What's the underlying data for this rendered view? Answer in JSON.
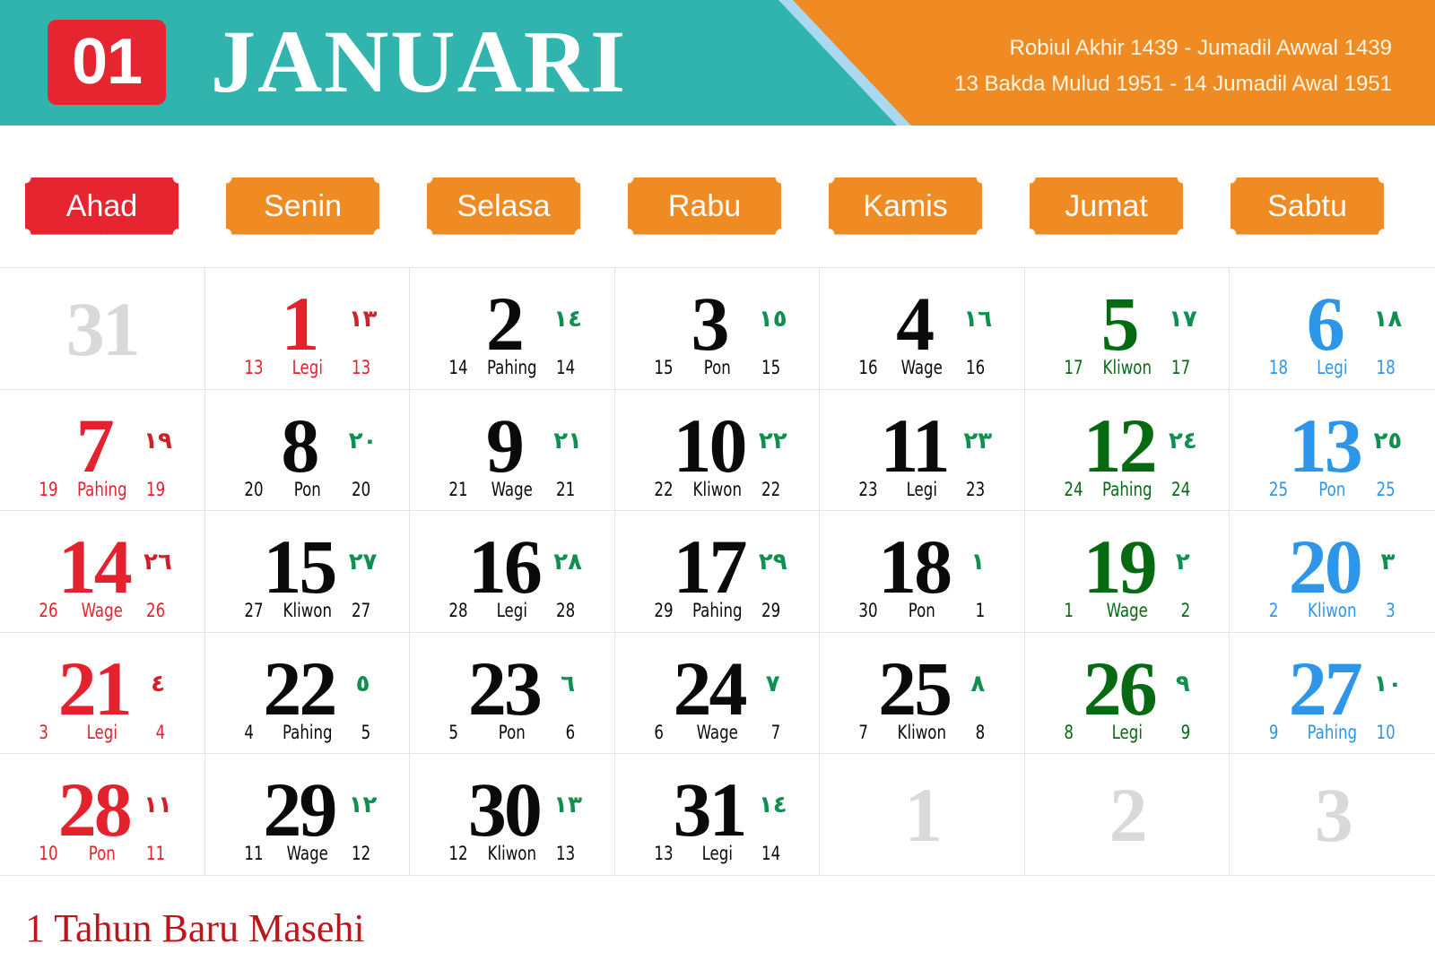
{
  "header": {
    "month_number": "01",
    "month_name": "JANUARI",
    "hijri_line": "Robiul Akhir 1439 - Jumadil Awwal 1439",
    "javanese_line": "13 Bakda Mulud 1951 - 14 Jumadil Awal 1951",
    "colors": {
      "teal": "#30b4ad",
      "orange": "#f08a22",
      "stripe": "#a9d8f0",
      "red": "#e62530"
    }
  },
  "weekdays": [
    "Ahad",
    "Senin",
    "Selasa",
    "Rabu",
    "Kamis",
    "Jumat",
    "Sabtu"
  ],
  "weeks": [
    [
      {
        "day": "31",
        "color": "grey",
        "arab": "",
        "left": "",
        "pasaran": "",
        "right": ""
      },
      {
        "day": "1",
        "color": "red",
        "arab": "١٣",
        "left": "13",
        "pasaran": "Legi",
        "right": "13"
      },
      {
        "day": "2",
        "color": "black",
        "arab": "١٤",
        "left": "14",
        "pasaran": "Pahing",
        "right": "14"
      },
      {
        "day": "3",
        "color": "black",
        "arab": "١٥",
        "left": "15",
        "pasaran": "Pon",
        "right": "15"
      },
      {
        "day": "4",
        "color": "black",
        "arab": "١٦",
        "left": "16",
        "pasaran": "Wage",
        "right": "16"
      },
      {
        "day": "5",
        "color": "green",
        "arab": "١٧",
        "left": "17",
        "pasaran": "Kliwon",
        "right": "17"
      },
      {
        "day": "6",
        "color": "blue",
        "arab": "١٨",
        "left": "18",
        "pasaran": "Legi",
        "right": "18"
      }
    ],
    [
      {
        "day": "7",
        "color": "red",
        "arab": "١٩",
        "left": "19",
        "pasaran": "Pahing",
        "right": "19"
      },
      {
        "day": "8",
        "color": "black",
        "arab": "٢٠",
        "left": "20",
        "pasaran": "Pon",
        "right": "20"
      },
      {
        "day": "9",
        "color": "black",
        "arab": "٢١",
        "left": "21",
        "pasaran": "Wage",
        "right": "21"
      },
      {
        "day": "10",
        "color": "black",
        "arab": "٢٢",
        "left": "22",
        "pasaran": "Kliwon",
        "right": "22"
      },
      {
        "day": "11",
        "color": "black",
        "arab": "٢٣",
        "left": "23",
        "pasaran": "Legi",
        "right": "23"
      },
      {
        "day": "12",
        "color": "green",
        "arab": "٢٤",
        "left": "24",
        "pasaran": "Pahing",
        "right": "24"
      },
      {
        "day": "13",
        "color": "blue",
        "arab": "٢٥",
        "left": "25",
        "pasaran": "Pon",
        "right": "25"
      }
    ],
    [
      {
        "day": "14",
        "color": "red",
        "arab": "٢٦",
        "left": "26",
        "pasaran": "Wage",
        "right": "26"
      },
      {
        "day": "15",
        "color": "black",
        "arab": "٢٧",
        "left": "27",
        "pasaran": "Kliwon",
        "right": "27"
      },
      {
        "day": "16",
        "color": "black",
        "arab": "٢٨",
        "left": "28",
        "pasaran": "Legi",
        "right": "28"
      },
      {
        "day": "17",
        "color": "black",
        "arab": "٢٩",
        "left": "29",
        "pasaran": "Pahing",
        "right": "29"
      },
      {
        "day": "18",
        "color": "black",
        "arab": "١",
        "left": "30",
        "pasaran": "Pon",
        "right": "1"
      },
      {
        "day": "19",
        "color": "green",
        "arab": "٢",
        "left": "1",
        "pasaran": "Wage",
        "right": "2"
      },
      {
        "day": "20",
        "color": "blue",
        "arab": "٣",
        "left": "2",
        "pasaran": "Kliwon",
        "right": "3"
      }
    ],
    [
      {
        "day": "21",
        "color": "red",
        "arab": "٤",
        "left": "3",
        "pasaran": "Legi",
        "right": "4"
      },
      {
        "day": "22",
        "color": "black",
        "arab": "٥",
        "left": "4",
        "pasaran": "Pahing",
        "right": "5"
      },
      {
        "day": "23",
        "color": "black",
        "arab": "٦",
        "left": "5",
        "pasaran": "Pon",
        "right": "6"
      },
      {
        "day": "24",
        "color": "black",
        "arab": "٧",
        "left": "6",
        "pasaran": "Wage",
        "right": "7"
      },
      {
        "day": "25",
        "color": "black",
        "arab": "٨",
        "left": "7",
        "pasaran": "Kliwon",
        "right": "8"
      },
      {
        "day": "26",
        "color": "green",
        "arab": "٩",
        "left": "8",
        "pasaran": "Legi",
        "right": "9"
      },
      {
        "day": "27",
        "color": "blue",
        "arab": "١٠",
        "left": "9",
        "pasaran": "Pahing",
        "right": "10"
      }
    ],
    [
      {
        "day": "28",
        "color": "red",
        "arab": "١١",
        "left": "10",
        "pasaran": "Pon",
        "right": "11"
      },
      {
        "day": "29",
        "color": "black",
        "arab": "١٢",
        "left": "11",
        "pasaran": "Wage",
        "right": "12"
      },
      {
        "day": "30",
        "color": "black",
        "arab": "١٣",
        "left": "12",
        "pasaran": "Kliwon",
        "right": "13"
      },
      {
        "day": "31",
        "color": "black",
        "arab": "١٤",
        "left": "13",
        "pasaran": "Legi",
        "right": "14"
      },
      {
        "day": "1",
        "color": "grey",
        "arab": "",
        "left": "",
        "pasaran": "",
        "right": ""
      },
      {
        "day": "2",
        "color": "grey",
        "arab": "",
        "left": "",
        "pasaran": "",
        "right": ""
      },
      {
        "day": "3",
        "color": "grey",
        "arab": "",
        "left": "",
        "pasaran": "",
        "right": ""
      }
    ]
  ],
  "holidays": [
    "1 Tahun Baru Masehi"
  ]
}
